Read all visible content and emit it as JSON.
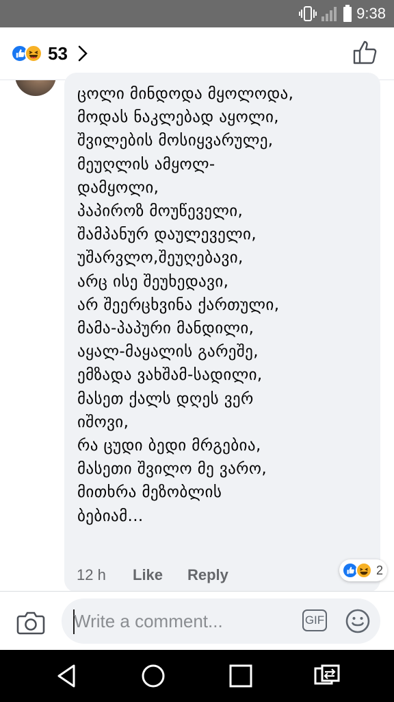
{
  "status_bar": {
    "time": "9:38"
  },
  "header": {
    "reaction_count": "53",
    "reactions": [
      "like-icon",
      "haha-icon"
    ]
  },
  "comment": {
    "text": "ცოლი მინდოდა მყოლოდა,\nმოდას ნაკლებად აყოლი,\nშვილების მოსიყვარულე,\nმეუღლის ამყოლ-\nდამყოლი,\nპაპიროზ მოუწეველი,\nშამპანურ დაულეველი,\nუშარვლო,შეუღებავი,\nარც ისე შეუხედავი,\nარ შეერცხვინა ქართული,\nმამა-პაპური მანდილი,\nაყალ-მაყალის გარეშე,\nემზადა ვახშამ-სადილი,\nმასეთ ქალს დღეს ვერ\nიშოვი,\nრა ცუდი ბედი მრგებია,\nმასეთი შვილო მე ვარო,\nმითხრა მეზობლის\nბებიამ...",
    "time": "12 h",
    "like_label": "Like",
    "reply_label": "Reply",
    "reaction_count": "2"
  },
  "composer": {
    "placeholder": "Write a comment...",
    "gif_label": "GIF"
  },
  "colors": {
    "accent": "#1877f2",
    "haha": "#f7b125",
    "status_bar": "#6b6b6b",
    "bubble": "#f0f2f5"
  }
}
